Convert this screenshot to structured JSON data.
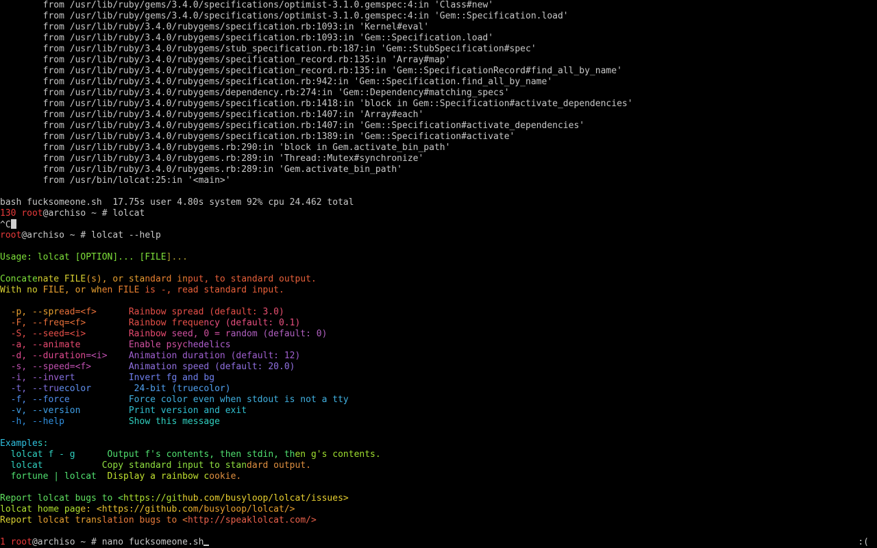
{
  "terminal": {
    "background": "#000000",
    "foreground": "#c8c8c8",
    "lines": [
      {
        "row": 0,
        "segments": [
          {
            "text": "        from /usr/lib/ruby/gems/3.4.0/specifications/optimist-3.1.0.gemspec:4:in 'Class#new'",
            "color": "#c8c8c8"
          }
        ]
      },
      {
        "row": 1,
        "segments": [
          {
            "text": "        from /usr/lib/ruby/gems/3.4.0/specifications/optimist-3.1.0.gemspec:4:in 'Gem::Specification.load'",
            "color": "#c8c8c8"
          }
        ]
      },
      {
        "row": 2,
        "segments": [
          {
            "text": "        from /usr/lib/ruby/3.4.0/rubygems/specification.rb:1093:in 'Kernel#eval'",
            "color": "#c8c8c8"
          }
        ]
      },
      {
        "row": 3,
        "segments": [
          {
            "text": "        from /usr/lib/ruby/3.4.0/rubygems/specification.rb:1093:in 'Gem::Specification.load'",
            "color": "#c8c8c8"
          }
        ]
      },
      {
        "row": 4,
        "segments": [
          {
            "text": "        from /usr/lib/ruby/3.4.0/rubygems/stub_specification.rb:187:in 'Gem::StubSpecification#spec'",
            "color": "#c8c8c8"
          }
        ]
      },
      {
        "row": 5,
        "segments": [
          {
            "text": "        from /usr/lib/ruby/3.4.0/rubygems/specification_record.rb:135:in 'Array#map'",
            "color": "#c8c8c8"
          }
        ]
      },
      {
        "row": 6,
        "segments": [
          {
            "text": "        from /usr/lib/ruby/3.4.0/rubygems/specification_record.rb:135:in 'Gem::SpecificationRecord#find_all_by_name'",
            "color": "#c8c8c8"
          }
        ]
      },
      {
        "row": 7,
        "segments": [
          {
            "text": "        from /usr/lib/ruby/3.4.0/rubygems/specification.rb:942:in 'Gem::Specification.find_all_by_name'",
            "color": "#c8c8c8"
          }
        ]
      },
      {
        "row": 8,
        "segments": [
          {
            "text": "        from /usr/lib/ruby/3.4.0/rubygems/dependency.rb:274:in 'Gem::Dependency#matching_specs'",
            "color": "#c8c8c8"
          }
        ]
      },
      {
        "row": 9,
        "segments": [
          {
            "text": "        from /usr/lib/ruby/3.4.0/rubygems/specification.rb:1418:in 'block in Gem::Specification#activate_dependencies'",
            "color": "#c8c8c8"
          }
        ]
      },
      {
        "row": 10,
        "segments": [
          {
            "text": "        from /usr/lib/ruby/3.4.0/rubygems/specification.rb:1407:in 'Array#each'",
            "color": "#c8c8c8"
          }
        ]
      },
      {
        "row": 11,
        "segments": [
          {
            "text": "        from /usr/lib/ruby/3.4.0/rubygems/specification.rb:1407:in 'Gem::Specification#activate_dependencies'",
            "color": "#c8c8c8"
          }
        ]
      },
      {
        "row": 12,
        "segments": [
          {
            "text": "        from /usr/lib/ruby/3.4.0/rubygems/specification.rb:1389:in 'Gem::Specification#activate'",
            "color": "#c8c8c8"
          }
        ]
      },
      {
        "row": 13,
        "segments": [
          {
            "text": "        from /usr/lib/ruby/3.4.0/rubygems.rb:290:in 'block in Gem.activate_bin_path'",
            "color": "#c8c8c8"
          }
        ]
      },
      {
        "row": 14,
        "segments": [
          {
            "text": "        from /usr/lib/ruby/3.4.0/rubygems.rb:289:in 'Thread::Mutex#synchronize'",
            "color": "#c8c8c8"
          }
        ]
      },
      {
        "row": 15,
        "segments": [
          {
            "text": "        from /usr/lib/ruby/3.4.0/rubygems.rb:289:in 'Gem.activate_bin_path'",
            "color": "#c8c8c8"
          }
        ]
      },
      {
        "row": 16,
        "segments": [
          {
            "text": "        from /usr/bin/lolcat:25:in '<main>'",
            "color": "#c8c8c8"
          }
        ]
      },
      {
        "row": 18,
        "segments": [
          {
            "text": "bash fucksomeone.sh  17.75s user 4.80s system 92% cpu 24.462 total",
            "color": "#c8c8c8"
          }
        ]
      },
      {
        "row": 19,
        "segments": [
          {
            "text": "130 ",
            "color": "#e83a3a"
          },
          {
            "text": "root",
            "color": "#e83a3a"
          },
          {
            "text": "@archiso ~ # lolcat",
            "color": "#c8c8c8"
          }
        ]
      },
      {
        "row": 20,
        "segments": [
          {
            "text": "^C",
            "color": "#c8c8c8"
          }
        ],
        "cursor": "block"
      },
      {
        "row": 21,
        "segments": [
          {
            "text": "root",
            "color": "#e83a3a"
          },
          {
            "text": "@archiso ~ # lolcat --help",
            "color": "#c8c8c8"
          }
        ]
      },
      {
        "row": 23,
        "segments": [
          {
            "text": "Usage: lolcat [OPTION]... [FILE",
            "color": "#7ee03a"
          },
          {
            "text": "]...",
            "color": "#b0a030"
          }
        ]
      },
      {
        "row": 25,
        "segments": [
          {
            "text": "Concate",
            "color": "#7ee03a"
          },
          {
            "text": "nate FILE",
            "color": "#d8d030"
          },
          {
            "text": "(s), or sta",
            "color": "#e8a030"
          },
          {
            "text": "ndard in",
            "color": "#e88030"
          },
          {
            "text": "put, to standard output.",
            "color": "#e8603a"
          }
        ]
      },
      {
        "row": 26,
        "segments": [
          {
            "text": "With no ",
            "color": "#d8d030"
          },
          {
            "text": "FILE, or wh",
            "color": "#e8a030"
          },
          {
            "text": "en FILE ",
            "color": "#e88030"
          },
          {
            "text": "is -, read standard input.",
            "color": "#e8603a"
          }
        ]
      },
      {
        "row": 28,
        "segments": [
          {
            "text": "  -p, --spr",
            "color": "#e8a030"
          },
          {
            "text": "ead=<f>      ",
            "color": "#e8703a"
          },
          {
            "text": "Rainbow spread (default: ",
            "color": "#e8504a"
          },
          {
            "text": "3.0)",
            "color": "#e85070"
          }
        ]
      },
      {
        "row": 29,
        "segments": [
          {
            "text": "  -F, --freq=<f>        ",
            "color": "#e8703a"
          },
          {
            "text": "Rainbow freque",
            "color": "#e8504a"
          },
          {
            "text": "ncy (default: 0.1)",
            "color": "#e85080"
          }
        ]
      },
      {
        "row": 30,
        "segments": [
          {
            "text": "  -S, --seed=<i>        ",
            "color": "#e8504a"
          },
          {
            "text": "Rainbow ",
            "color": "#e84a70"
          },
          {
            "text": "seed, 0 = r",
            "color": "#d050a0"
          },
          {
            "text": "andom (default: 0)",
            "color": "#b060c0"
          }
        ]
      },
      {
        "row": 31,
        "segments": [
          {
            "text": "  -a, --animate         ",
            "color": "#e84a70"
          },
          {
            "text": "Enable psyc",
            "color": "#d050a0"
          },
          {
            "text": "hedelics",
            "color": "#b060d0"
          }
        ]
      },
      {
        "row": 32,
        "segments": [
          {
            "text": "  -d, --duration",
            "color": "#e04a90"
          },
          {
            "text": "=<i>    ",
            "color": "#c050b0"
          },
          {
            "text": "Animation duration (default: 12)",
            "color": "#a060d0"
          }
        ]
      },
      {
        "row": 33,
        "segments": [
          {
            "text": "  -s, --speed=<f>       ",
            "color": "#c050b0"
          },
          {
            "text": "Animation speed (default: 20.0)",
            "color": "#9070e0"
          }
        ]
      },
      {
        "row": 34,
        "segments": [
          {
            "text": "  -i, --inv",
            "color": "#a060d0"
          },
          {
            "text": "ert          ",
            "color": "#8070e0"
          },
          {
            "text": "Invert fg and bg",
            "color": "#7080f0"
          }
        ]
      },
      {
        "row": 35,
        "segments": [
          {
            "text": "  -t, --tru",
            "color": "#8070e0"
          },
          {
            "text": "ecolor        ",
            "color": "#6090f0"
          },
          {
            "text": "24-bit (truecolor)",
            "color": "#50a0f0"
          }
        ]
      },
      {
        "row": 36,
        "segments": [
          {
            "text": "  -f, --force           ",
            "color": "#5090f0"
          },
          {
            "text": "Force color even when stdout is not a tty",
            "color": "#40b0e0"
          }
        ]
      },
      {
        "row": 37,
        "segments": [
          {
            "text": "  -v, --version         ",
            "color": "#40a0e8"
          },
          {
            "text": "Print version and exit",
            "color": "#30c0d0"
          }
        ]
      },
      {
        "row": 38,
        "segments": [
          {
            "text": "  -h, --help            ",
            "color": "#3090e0"
          },
          {
            "text": "Show this message",
            "color": "#30d0c0"
          }
        ]
      },
      {
        "row": 40,
        "segments": [
          {
            "text": "Example",
            "color": "#30c0e0"
          },
          {
            "text": "s:",
            "color": "#30d0c0"
          }
        ]
      },
      {
        "row": 41,
        "segments": [
          {
            "text": "  lolcat f - g      ",
            "color": "#30d0c0"
          },
          {
            "text": "Output f's contents, then stdin, th",
            "color": "#50e070"
          },
          {
            "text": "en g's contents.",
            "color": "#a0e030"
          }
        ]
      },
      {
        "row": 42,
        "segments": [
          {
            "text": "  lolcat           ",
            "color": "#30d0c0"
          },
          {
            "text": "Copy standard input to stan",
            "color": "#90e040"
          },
          {
            "text": "dard output.",
            "color": "#e09040"
          }
        ]
      },
      {
        "row": 43,
        "segments": [
          {
            "text": "  fortune | lolcat  ",
            "color": "#50e070"
          },
          {
            "text": "Display a rainbow c",
            "color": "#c0e030"
          },
          {
            "text": "ookie.",
            "color": "#e09040"
          }
        ]
      },
      {
        "row": 45,
        "segments": [
          {
            "text": "Report lolcat bugs to <",
            "color": "#60e060"
          },
          {
            "text": "https://git",
            "color": "#b0e030"
          },
          {
            "text": "hub.com/busyloop/lolcat/issues>",
            "color": "#e8d030"
          }
        ]
      },
      {
        "row": 46,
        "segments": [
          {
            "text": "lolcat home pag",
            "color": "#b0e030"
          },
          {
            "text": "e: <https://github.co",
            "color": "#e8c030"
          },
          {
            "text": "m/busyloop/lolcat/>",
            "color": "#e8a030"
          }
        ]
      },
      {
        "row": 47,
        "segments": [
          {
            "text": "Report ",
            "color": "#d8d030"
          },
          {
            "text": "lolcat trans",
            "color": "#e8a030"
          },
          {
            "text": "lation bugs to <",
            "color": "#e87a3a"
          },
          {
            "text": "http://speaklolcat.com/>",
            "color": "#e8604a"
          }
        ]
      },
      {
        "row": 49,
        "segments": [
          {
            "text": "1 ",
            "color": "#e83a3a"
          },
          {
            "text": "root",
            "color": "#e83a3a"
          },
          {
            "text": "@archiso ~ # nano fucksomeone.sh",
            "color": "#c8c8c8"
          }
        ],
        "cursor": "underline"
      }
    ],
    "right_indicator": ":("
  }
}
